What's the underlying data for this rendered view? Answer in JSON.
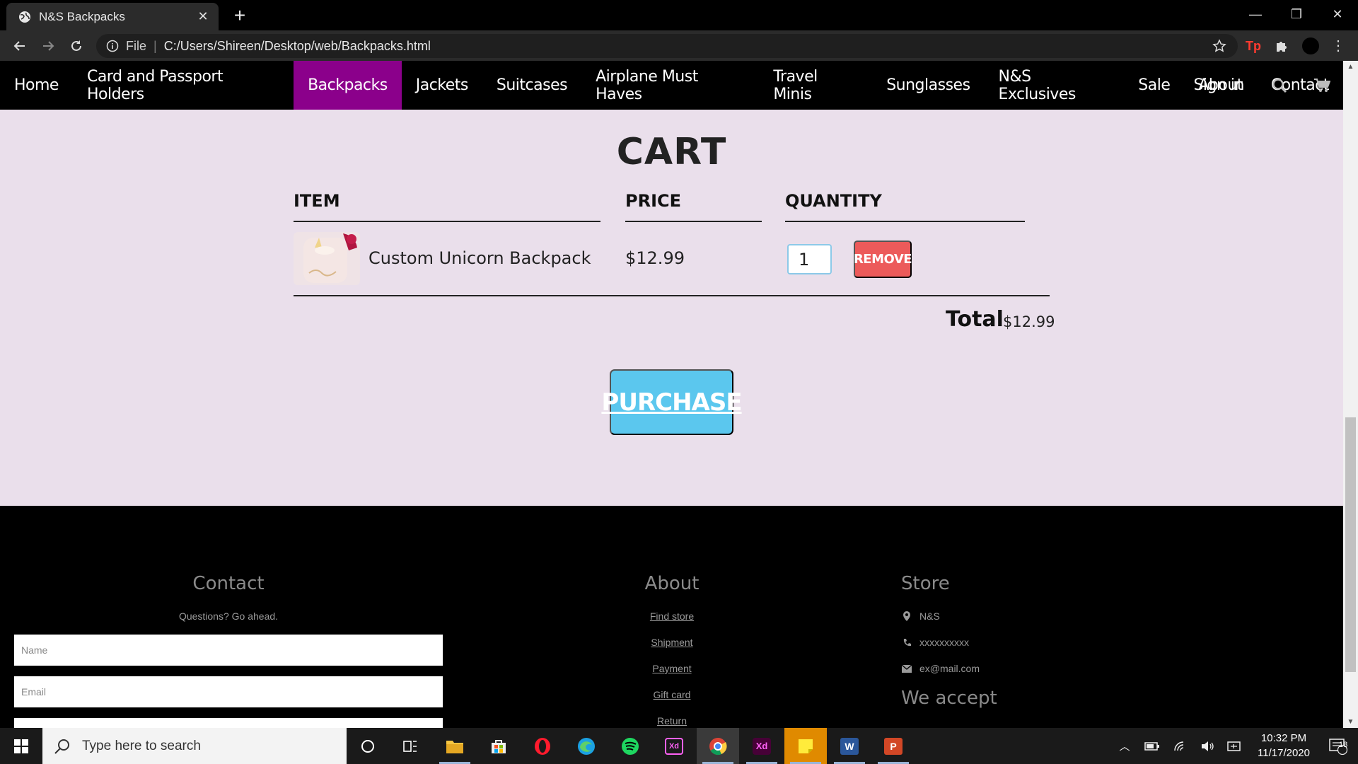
{
  "browser": {
    "tab_title": "N&S Backpacks",
    "url_scheme_label": "File",
    "url": "C:/Users/Shireen/Desktop/web/Backpacks.html"
  },
  "nav": {
    "items": [
      {
        "label": "Home"
      },
      {
        "label": "Card and Passport Holders"
      },
      {
        "label": "Backpacks",
        "active": true
      },
      {
        "label": "Jackets"
      },
      {
        "label": "Suitcases"
      },
      {
        "label": "Airplane Must Haves"
      },
      {
        "label": "Travel Minis"
      },
      {
        "label": "Sunglasses"
      },
      {
        "label": "N&S Exclusives"
      },
      {
        "label": "Sale"
      },
      {
        "label": "About"
      },
      {
        "label": "Contact"
      }
    ],
    "sign_in": "Sign in",
    "active_color": "#8b008b"
  },
  "cart": {
    "title": "CART",
    "headers": {
      "item": "ITEM",
      "price": "PRICE",
      "quantity": "QUANTITY"
    },
    "rows": [
      {
        "name": "Custom Unicorn Backpack",
        "price": "$12.99",
        "quantity": "1",
        "remove_label": "REMOVE"
      }
    ],
    "total_label": "Total",
    "total_value": "$12.99",
    "purchase_label": "PURCHASE",
    "colors": {
      "background": "#eadfeb",
      "remove": "#ec5a5a",
      "purchase": "#5bc7ee"
    }
  },
  "footer": {
    "contact": {
      "heading": "Contact",
      "subtext": "Questions? Go ahead.",
      "name_placeholder": "Name",
      "email_placeholder": "Email"
    },
    "about": {
      "heading": "About",
      "links": [
        "Find store",
        "Shipment",
        "Payment",
        "Gift card",
        "Return"
      ]
    },
    "store": {
      "heading": "Store",
      "name": "N&S",
      "phone": "xxxxxxxxxx",
      "email": "ex@mail.com",
      "accept_heading": "We accept"
    }
  },
  "taskbar": {
    "search_placeholder": "Type here to search",
    "time": "10:32 PM",
    "date": "11/17/2020",
    "notification_count": "18"
  }
}
